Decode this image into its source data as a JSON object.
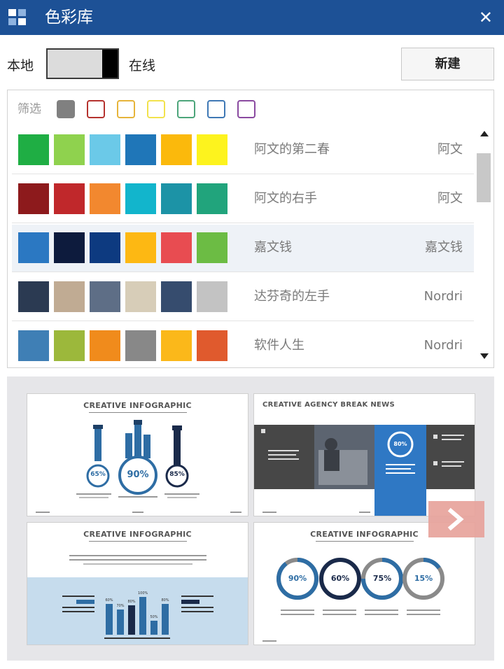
{
  "window": {
    "title": "色彩库",
    "close_glyph": "✕"
  },
  "source_toggle": {
    "left_label": "本地",
    "right_label": "在线",
    "selected": "在线"
  },
  "toolbar": {
    "new_label": "新建"
  },
  "filter": {
    "label": "筛选",
    "colors": [
      "#808080",
      "#b5322e",
      "#e6b43a",
      "#f2e24c",
      "#4ca57a",
      "#3f78b5",
      "#8a4aa0"
    ]
  },
  "palettes": [
    {
      "name": "阿文的第二春",
      "author": "阿文",
      "colors": [
        "#1fae44",
        "#8fd24e",
        "#6bc9e8",
        "#1f76b8",
        "#fbb90c",
        "#fdf31e"
      ]
    },
    {
      "name": "阿文的右手",
      "author": "阿文",
      "colors": [
        "#8d1a1c",
        "#c0282b",
        "#f2882f",
        "#12b5cc",
        "#1c93a6",
        "#21a47c"
      ]
    },
    {
      "name": "嘉文钱",
      "author": "嘉文钱",
      "colors": [
        "#2b78c2",
        "#0d1b3d",
        "#0d3a80",
        "#fdb813",
        "#e84c51",
        "#6cbc44"
      ],
      "selected": true
    },
    {
      "name": "达芬奇的左手",
      "author": "Nordri",
      "colors": [
        "#2b3a52",
        "#c0ab93",
        "#5e6e86",
        "#d7cdb8",
        "#364c6e",
        "#c3c3c3"
      ]
    },
    {
      "name": "软件人生",
      "author": "Nordri",
      "colors": [
        "#3f7fb5",
        "#9cb83b",
        "#f08b1c",
        "#888888",
        "#fbb81a",
        "#e05a2d"
      ]
    }
  ],
  "previews": [
    {
      "title": "CREATIVE INFOGRAPHIC",
      "percents": [
        "65%",
        "90%",
        "85%"
      ]
    },
    {
      "title": "CREATIVE AGENCY BREAK NEWS",
      "percents": [
        "80%"
      ]
    },
    {
      "title": "CREATIVE INFOGRAPHIC",
      "bar_labels": [
        "60%",
        "70%",
        "80%",
        "100%",
        "50%",
        "80%"
      ]
    },
    {
      "title": "CREATIVE INFOGRAPHIC",
      "percents": [
        "90%",
        "60%",
        "75%",
        "15%"
      ]
    }
  ],
  "icons": {
    "app": "grid-icon",
    "close": "close-icon",
    "next": "chevron-right-icon",
    "scroll_up": "scroll-up-arrow-icon",
    "scroll_down": "scroll-down-arrow-icon"
  }
}
